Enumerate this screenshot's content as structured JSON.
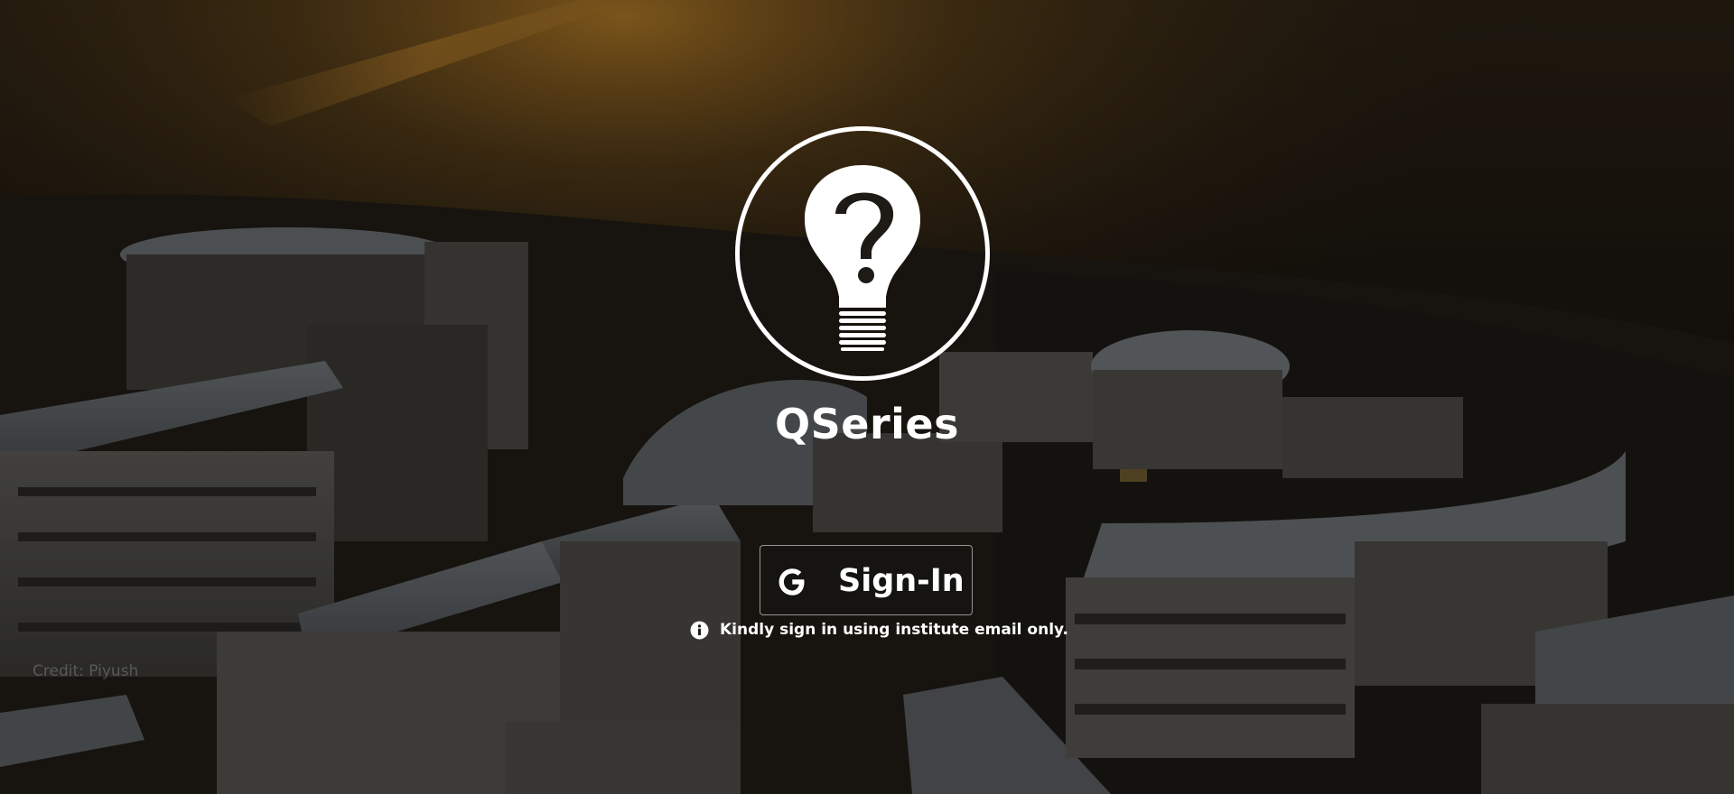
{
  "app": {
    "title": "QSeries"
  },
  "logo": {
    "icon": "question-bulb-icon"
  },
  "signin": {
    "label": "Sign-In",
    "icon": "google-g-icon"
  },
  "notice": {
    "text": "Kindly sign in using institute email only.",
    "icon": "info-icon"
  },
  "background": {
    "watermark": "Credit: Piyush",
    "description_colors": {
      "overlay": "#000000",
      "glow": "#c8871e"
    }
  },
  "colors": {
    "foreground": "#ffffff",
    "button_border": "#bdbdbd"
  }
}
